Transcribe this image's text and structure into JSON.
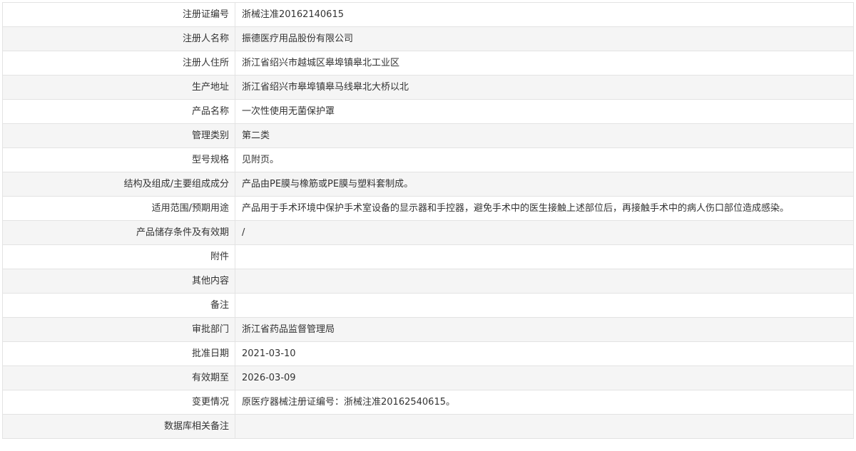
{
  "rows": [
    {
      "label": "注册证编号",
      "value": "浙械注准20162140615"
    },
    {
      "label": "注册人名称",
      "value": "振德医疗用品股份有限公司"
    },
    {
      "label": "注册人住所",
      "value": "浙江省绍兴市越城区皋埠镇皋北工业区"
    },
    {
      "label": "生产地址",
      "value": "浙江省绍兴市皋埠镇皋马线皋北大桥以北"
    },
    {
      "label": "产品名称",
      "value": "一次性使用无菌保护罩"
    },
    {
      "label": "管理类别",
      "value": "第二类"
    },
    {
      "label": "型号规格",
      "value": "见附页。"
    },
    {
      "label": "结构及组成/主要组成成分",
      "value": "产品由PE膜与橡筋或PE膜与塑料套制成。"
    },
    {
      "label": "适用范围/预期用途",
      "value": "产品用于手术环境中保护手术室设备的显示器和手控器，避免手术中的医生接触上述部位后，再接触手术中的病人伤口部位造成感染。"
    },
    {
      "label": "产品储存条件及有效期",
      "value": "/"
    },
    {
      "label": "附件",
      "value": ""
    },
    {
      "label": "其他内容",
      "value": ""
    },
    {
      "label": "备注",
      "value": ""
    },
    {
      "label": "审批部门",
      "value": "浙江省药品监督管理局"
    },
    {
      "label": "批准日期",
      "value": "2021-03-10"
    },
    {
      "label": "有效期至",
      "value": "2026-03-09"
    },
    {
      "label": "变更情况",
      "value": "原医疗器械注册证编号：浙械注准20162540615。"
    },
    {
      "label": "数据库相关备注",
      "value": ""
    }
  ]
}
